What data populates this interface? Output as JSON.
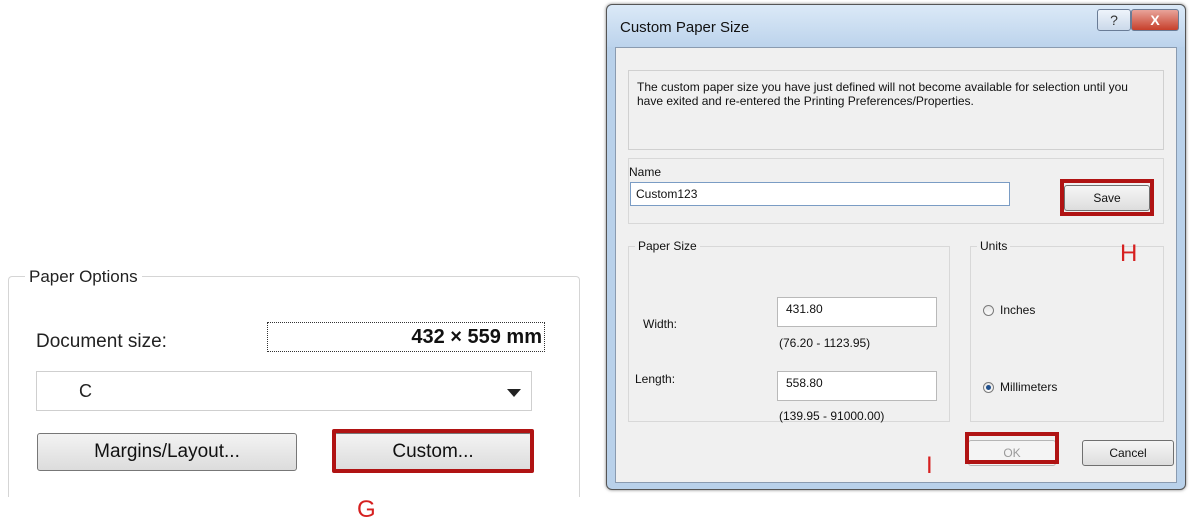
{
  "paper_options": {
    "legend": "Paper Options",
    "document_size_label": "Document size:",
    "document_size_value": "432 × 559 mm",
    "size_selected": "C",
    "margins_button": "Margins/Layout...",
    "custom_button": "Custom..."
  },
  "markers": {
    "g": "G",
    "h": "H",
    "i": "I"
  },
  "dialog": {
    "title": "Custom Paper Size",
    "help_glyph": "?",
    "close_glyph": "X",
    "info_text": "The custom paper size you have just defined will not become available for selection until you have exited and re-entered the Printing Preferences/Properties.",
    "name_label": "Name",
    "name_value": "Custom123",
    "save_button": "Save",
    "paper_size_group": "Paper Size",
    "width_label": "Width:",
    "width_value": "431.80",
    "width_range": "(76.20 - 1123.95)",
    "length_label": "Length:",
    "length_value": "558.80",
    "length_range": "(139.95 - 91000.00)",
    "units_group": "Units",
    "unit_inches": "Inches",
    "unit_millimeters": "Millimeters",
    "selected_unit": "Millimeters",
    "ok_button": "OK",
    "cancel_button": "Cancel"
  },
  "colors": {
    "highlight": "#b01313",
    "marker": "#d62020",
    "dialog_frame": "#b9d1ea"
  }
}
